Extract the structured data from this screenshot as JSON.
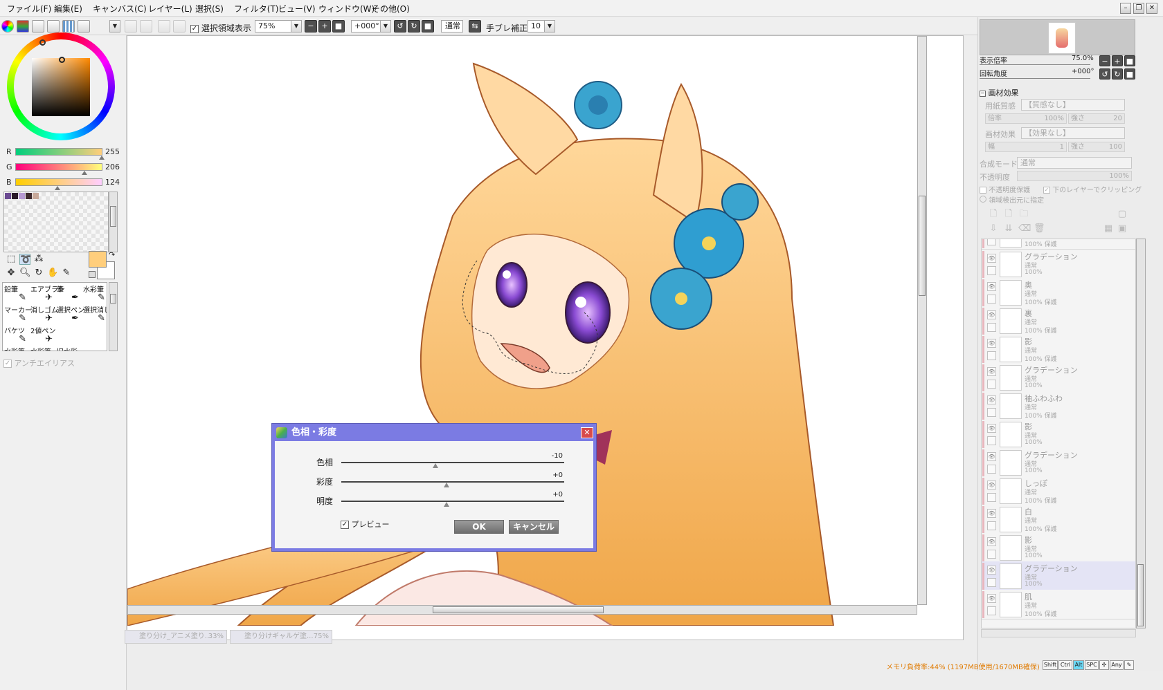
{
  "menu": [
    "ファイル(F)",
    "編集(E)",
    "キャンバス(C)",
    "レイヤー(L)",
    "選択(S)",
    "フィルタ(T)",
    "ビュー(V)",
    "ウィンドウ(W)",
    "その他(O)"
  ],
  "toolbar": {
    "selection_show_label": "選択領域表示",
    "zoom_value": "75%",
    "rotation_value": "+000°",
    "blend_mode": "通常",
    "stabilizer_label": "手ブレ補正",
    "stabilizer_value": "10"
  },
  "colors": {
    "r_label": "R",
    "r_value": "255",
    "g_label": "G",
    "g_value": "206",
    "b_label": "B",
    "b_value": "124",
    "current_color": "#ffce7c",
    "swatches": [
      "#6b4a92",
      "#2a1a2a",
      "#b79ad3",
      "#3e2a2e",
      "#c8a99a"
    ]
  },
  "brushes": [
    [
      "鉛筆",
      "エアブラシ",
      "筆",
      "水彩筆"
    ],
    [
      "マーカー",
      "消しゴム",
      "選択ペン",
      "選択消し"
    ],
    [
      "バケツ",
      "2値ペン",
      "",
      ""
    ],
    [
      "水彩筆",
      "水彩筆",
      "旧水彩",
      ""
    ]
  ],
  "antialias_label": "アンチエイリアス",
  "dialog": {
    "title": "色相・彩度",
    "hue_label": "色相",
    "hue_value": "-10",
    "saturation_label": "彩度",
    "saturation_value": "+0",
    "brightness_label": "明度",
    "brightness_value": "+0",
    "preview_label": "プレビュー",
    "ok_label": "OK",
    "cancel_label": "キャンセル"
  },
  "tabs": [
    {
      "name": "塗り分け_アニメ塗り...",
      "zoom": "33%"
    },
    {
      "name": "塗り分けギャルゲ塗...",
      "zoom": "75%"
    }
  ],
  "navigator": {
    "zoom_label": "表示倍率",
    "zoom_value": "75.0%",
    "angle_label": "回転角度",
    "angle_value": "+000°"
  },
  "texture": {
    "section_title": "画材効果",
    "paper_label": "用紙質感",
    "paper_value": "【質感なし】",
    "scale_label": "倍率",
    "scale_value": "100%",
    "strength_label": "強さ",
    "strength_value": "20",
    "effect_label": "画材効果",
    "effect_value": "【効果なし】",
    "width_label": "幅",
    "width_value": "1",
    "strength2_label": "強さ",
    "strength2_value": "100",
    "blend_label": "合成モード",
    "blend_value": "通常",
    "opacity_label": "不透明度",
    "opacity_value": "100%",
    "protect_label": "不透明度保護",
    "clip_label": "下のレイヤーでクリッピング",
    "source_label": "領域検出元に指定"
  },
  "layers": [
    {
      "name": "",
      "mode": "",
      "opacity": "100% 保護"
    },
    {
      "name": "グラデーション",
      "mode": "通常",
      "opacity": "100%"
    },
    {
      "name": "奥",
      "mode": "通常",
      "opacity": "100% 保護"
    },
    {
      "name": "裏",
      "mode": "通常",
      "opacity": "100% 保護"
    },
    {
      "name": "影",
      "mode": "通常",
      "opacity": "100% 保護"
    },
    {
      "name": "グラデーション",
      "mode": "通常",
      "opacity": "100%"
    },
    {
      "name": "袖ふわふわ",
      "mode": "通常",
      "opacity": "100% 保護"
    },
    {
      "name": "影",
      "mode": "通常",
      "opacity": "100%"
    },
    {
      "name": "グラデーション",
      "mode": "通常",
      "opacity": "100%"
    },
    {
      "name": "しっぽ",
      "mode": "通常",
      "opacity": "100% 保護"
    },
    {
      "name": "白",
      "mode": "通常",
      "opacity": "100% 保護"
    },
    {
      "name": "影",
      "mode": "通常",
      "opacity": "100%"
    },
    {
      "name": "グラデーション",
      "mode": "通常",
      "opacity": "100%"
    },
    {
      "name": "肌",
      "mode": "通常",
      "opacity": "100% 保護"
    }
  ],
  "status": {
    "memory": "メモリ負荷率:44% (1197MB使用/1670MB確保)",
    "keys": [
      "Shift",
      "Ctrl",
      "Alt",
      "SPC",
      "Any"
    ]
  }
}
